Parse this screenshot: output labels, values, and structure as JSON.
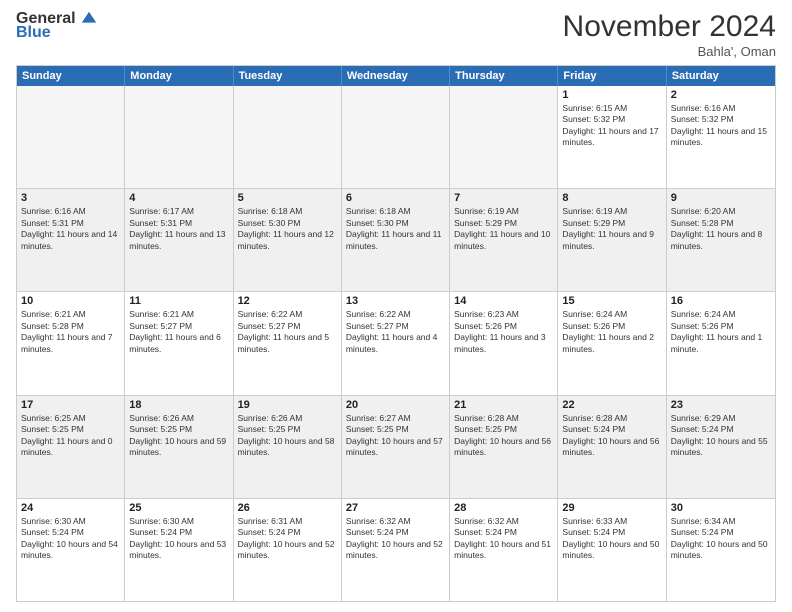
{
  "logo": {
    "general": "General",
    "blue": "Blue"
  },
  "title": "November 2024",
  "location": "Bahla', Oman",
  "days_of_week": [
    "Sunday",
    "Monday",
    "Tuesday",
    "Wednesday",
    "Thursday",
    "Friday",
    "Saturday"
  ],
  "rows": [
    [
      {
        "day": "",
        "info": "",
        "empty": true
      },
      {
        "day": "",
        "info": "",
        "empty": true
      },
      {
        "day": "",
        "info": "",
        "empty": true
      },
      {
        "day": "",
        "info": "",
        "empty": true
      },
      {
        "day": "",
        "info": "",
        "empty": true
      },
      {
        "day": "1",
        "info": "Sunrise: 6:15 AM\nSunset: 5:32 PM\nDaylight: 11 hours and 17 minutes."
      },
      {
        "day": "2",
        "info": "Sunrise: 6:16 AM\nSunset: 5:32 PM\nDaylight: 11 hours and 15 minutes."
      }
    ],
    [
      {
        "day": "3",
        "info": "Sunrise: 6:16 AM\nSunset: 5:31 PM\nDaylight: 11 hours and 14 minutes."
      },
      {
        "day": "4",
        "info": "Sunrise: 6:17 AM\nSunset: 5:31 PM\nDaylight: 11 hours and 13 minutes."
      },
      {
        "day": "5",
        "info": "Sunrise: 6:18 AM\nSunset: 5:30 PM\nDaylight: 11 hours and 12 minutes."
      },
      {
        "day": "6",
        "info": "Sunrise: 6:18 AM\nSunset: 5:30 PM\nDaylight: 11 hours and 11 minutes."
      },
      {
        "day": "7",
        "info": "Sunrise: 6:19 AM\nSunset: 5:29 PM\nDaylight: 11 hours and 10 minutes."
      },
      {
        "day": "8",
        "info": "Sunrise: 6:19 AM\nSunset: 5:29 PM\nDaylight: 11 hours and 9 minutes."
      },
      {
        "day": "9",
        "info": "Sunrise: 6:20 AM\nSunset: 5:28 PM\nDaylight: 11 hours and 8 minutes."
      }
    ],
    [
      {
        "day": "10",
        "info": "Sunrise: 6:21 AM\nSunset: 5:28 PM\nDaylight: 11 hours and 7 minutes."
      },
      {
        "day": "11",
        "info": "Sunrise: 6:21 AM\nSunset: 5:27 PM\nDaylight: 11 hours and 6 minutes."
      },
      {
        "day": "12",
        "info": "Sunrise: 6:22 AM\nSunset: 5:27 PM\nDaylight: 11 hours and 5 minutes."
      },
      {
        "day": "13",
        "info": "Sunrise: 6:22 AM\nSunset: 5:27 PM\nDaylight: 11 hours and 4 minutes."
      },
      {
        "day": "14",
        "info": "Sunrise: 6:23 AM\nSunset: 5:26 PM\nDaylight: 11 hours and 3 minutes."
      },
      {
        "day": "15",
        "info": "Sunrise: 6:24 AM\nSunset: 5:26 PM\nDaylight: 11 hours and 2 minutes."
      },
      {
        "day": "16",
        "info": "Sunrise: 6:24 AM\nSunset: 5:26 PM\nDaylight: 11 hours and 1 minute."
      }
    ],
    [
      {
        "day": "17",
        "info": "Sunrise: 6:25 AM\nSunset: 5:25 PM\nDaylight: 11 hours and 0 minutes."
      },
      {
        "day": "18",
        "info": "Sunrise: 6:26 AM\nSunset: 5:25 PM\nDaylight: 10 hours and 59 minutes."
      },
      {
        "day": "19",
        "info": "Sunrise: 6:26 AM\nSunset: 5:25 PM\nDaylight: 10 hours and 58 minutes."
      },
      {
        "day": "20",
        "info": "Sunrise: 6:27 AM\nSunset: 5:25 PM\nDaylight: 10 hours and 57 minutes."
      },
      {
        "day": "21",
        "info": "Sunrise: 6:28 AM\nSunset: 5:25 PM\nDaylight: 10 hours and 56 minutes."
      },
      {
        "day": "22",
        "info": "Sunrise: 6:28 AM\nSunset: 5:24 PM\nDaylight: 10 hours and 56 minutes."
      },
      {
        "day": "23",
        "info": "Sunrise: 6:29 AM\nSunset: 5:24 PM\nDaylight: 10 hours and 55 minutes."
      }
    ],
    [
      {
        "day": "24",
        "info": "Sunrise: 6:30 AM\nSunset: 5:24 PM\nDaylight: 10 hours and 54 minutes."
      },
      {
        "day": "25",
        "info": "Sunrise: 6:30 AM\nSunset: 5:24 PM\nDaylight: 10 hours and 53 minutes."
      },
      {
        "day": "26",
        "info": "Sunrise: 6:31 AM\nSunset: 5:24 PM\nDaylight: 10 hours and 52 minutes."
      },
      {
        "day": "27",
        "info": "Sunrise: 6:32 AM\nSunset: 5:24 PM\nDaylight: 10 hours and 52 minutes."
      },
      {
        "day": "28",
        "info": "Sunrise: 6:32 AM\nSunset: 5:24 PM\nDaylight: 10 hours and 51 minutes."
      },
      {
        "day": "29",
        "info": "Sunrise: 6:33 AM\nSunset: 5:24 PM\nDaylight: 10 hours and 50 minutes."
      },
      {
        "day": "30",
        "info": "Sunrise: 6:34 AM\nSunset: 5:24 PM\nDaylight: 10 hours and 50 minutes."
      }
    ]
  ]
}
